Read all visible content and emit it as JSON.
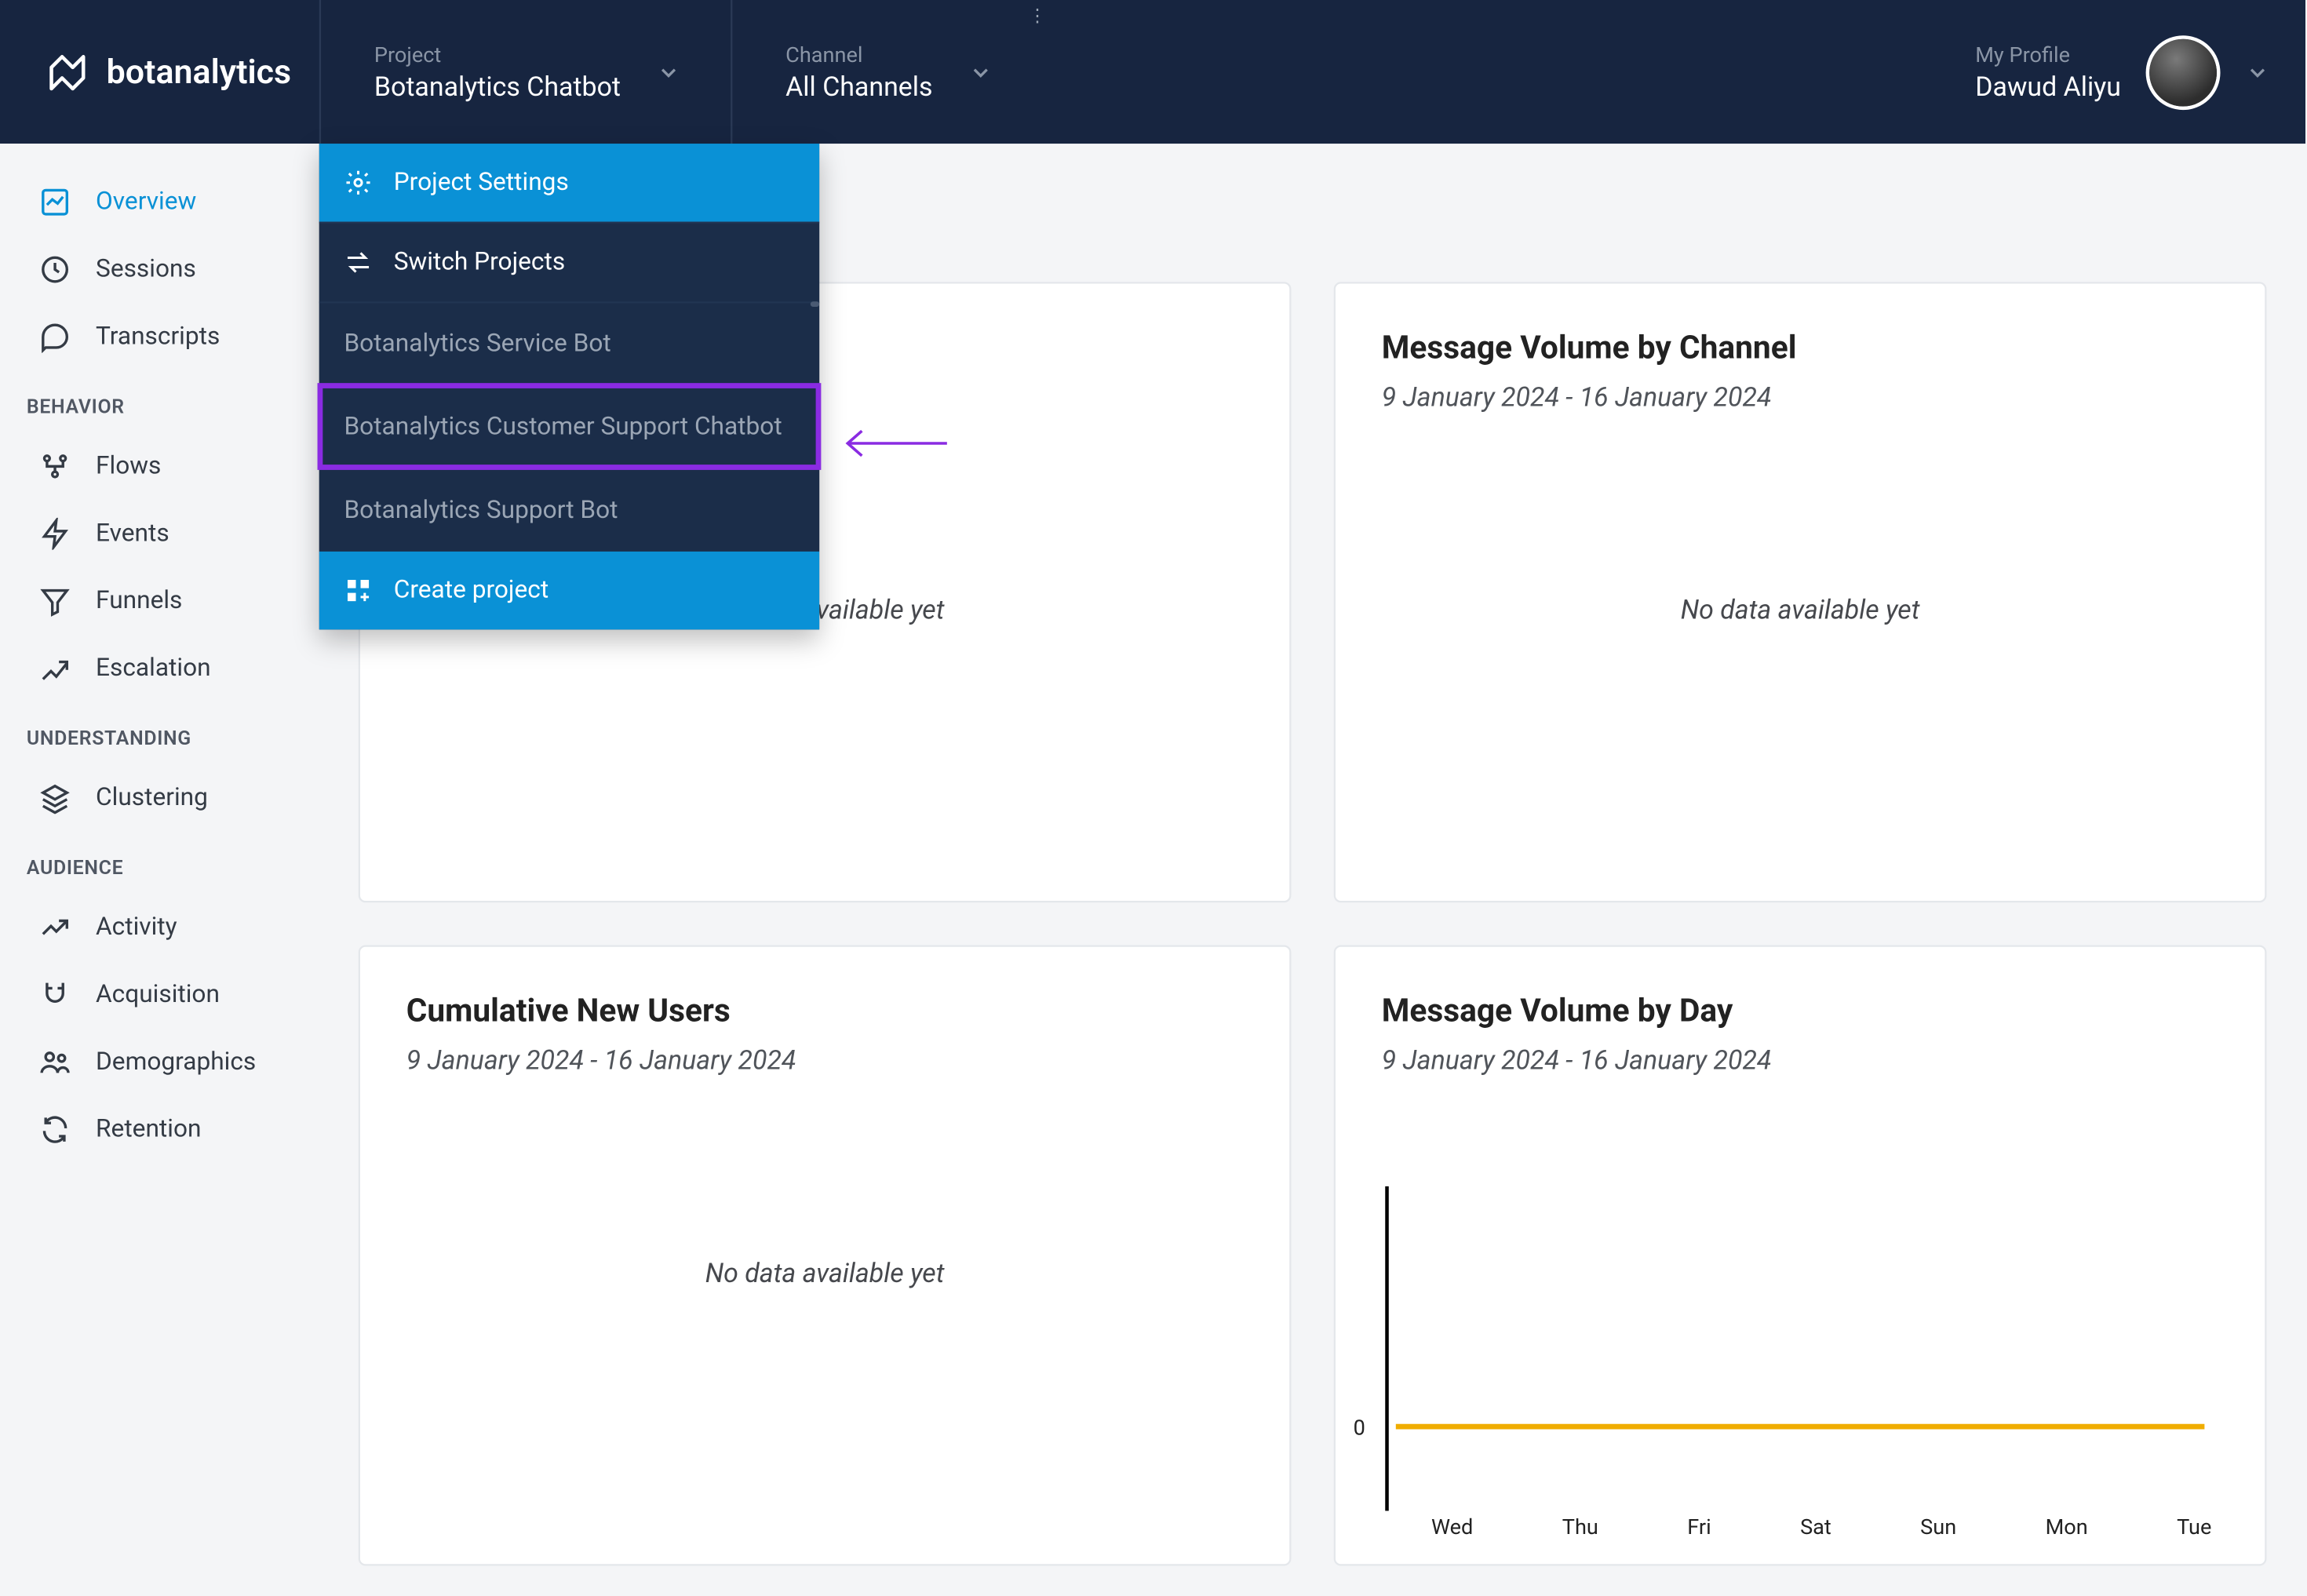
{
  "brand": "botanalytics",
  "header": {
    "project": {
      "label": "Project",
      "value": "Botanalytics Chatbot"
    },
    "channel": {
      "label": "Channel",
      "value": "All Channels"
    },
    "profile": {
      "label": "My Profile",
      "name": "Dawud Aliyu"
    }
  },
  "project_dropdown": {
    "settings": "Project Settings",
    "switch": "Switch Projects",
    "projects": [
      "Botanalytics Service Bot",
      "Botanalytics Customer Support Chatbot",
      "Botanalytics Support Bot"
    ],
    "create": "Create project"
  },
  "sidebar": {
    "items_top": [
      {
        "icon": "overview",
        "label": "Overview",
        "active": true
      },
      {
        "icon": "sessions",
        "label": "Sessions"
      },
      {
        "icon": "transcripts",
        "label": "Transcripts"
      }
    ],
    "section_behavior": "BEHAVIOR",
    "items_behavior": [
      {
        "icon": "flows",
        "label": "Flows"
      },
      {
        "icon": "events",
        "label": "Events"
      },
      {
        "icon": "funnels",
        "label": "Funnels"
      },
      {
        "icon": "escalation",
        "label": "Escalation"
      }
    ],
    "section_understanding": "UNDERSTANDING",
    "items_understanding": [
      {
        "icon": "clustering",
        "label": "Clustering"
      }
    ],
    "section_audience": "AUDIENCE",
    "items_audience": [
      {
        "icon": "activity",
        "label": "Activity"
      },
      {
        "icon": "acquisition",
        "label": "Acquisition"
      },
      {
        "icon": "demographics",
        "label": "Demographics"
      },
      {
        "icon": "retention",
        "label": "Retention"
      }
    ]
  },
  "cards": {
    "c1": {
      "title": "",
      "sub": "",
      "nodata": "No data available yet"
    },
    "c2": {
      "title": "Message Volume by Channel",
      "sub": "9 January 2024 - 16 January 2024",
      "nodata": "No data available yet"
    },
    "c3": {
      "title": "Cumulative New Users",
      "sub": "9 January 2024 - 16 January 2024",
      "nodata": "No data available yet"
    },
    "c4": {
      "title": "Message Volume by Day",
      "sub": "9 January 2024 - 16 January 2024"
    }
  },
  "chart_data": {
    "type": "line",
    "categories": [
      "Wed",
      "Thu",
      "Fri",
      "Sat",
      "Sun",
      "Mon",
      "Tue"
    ],
    "values": [
      0,
      0,
      0,
      0,
      0,
      0,
      0
    ],
    "ylabel_value": "0",
    "ylim": [
      0,
      1
    ]
  },
  "colors": {
    "accent": "#0a91d6",
    "header": "#172540",
    "chart_line": "#f0ad00",
    "highlight": "#8a2be2"
  }
}
